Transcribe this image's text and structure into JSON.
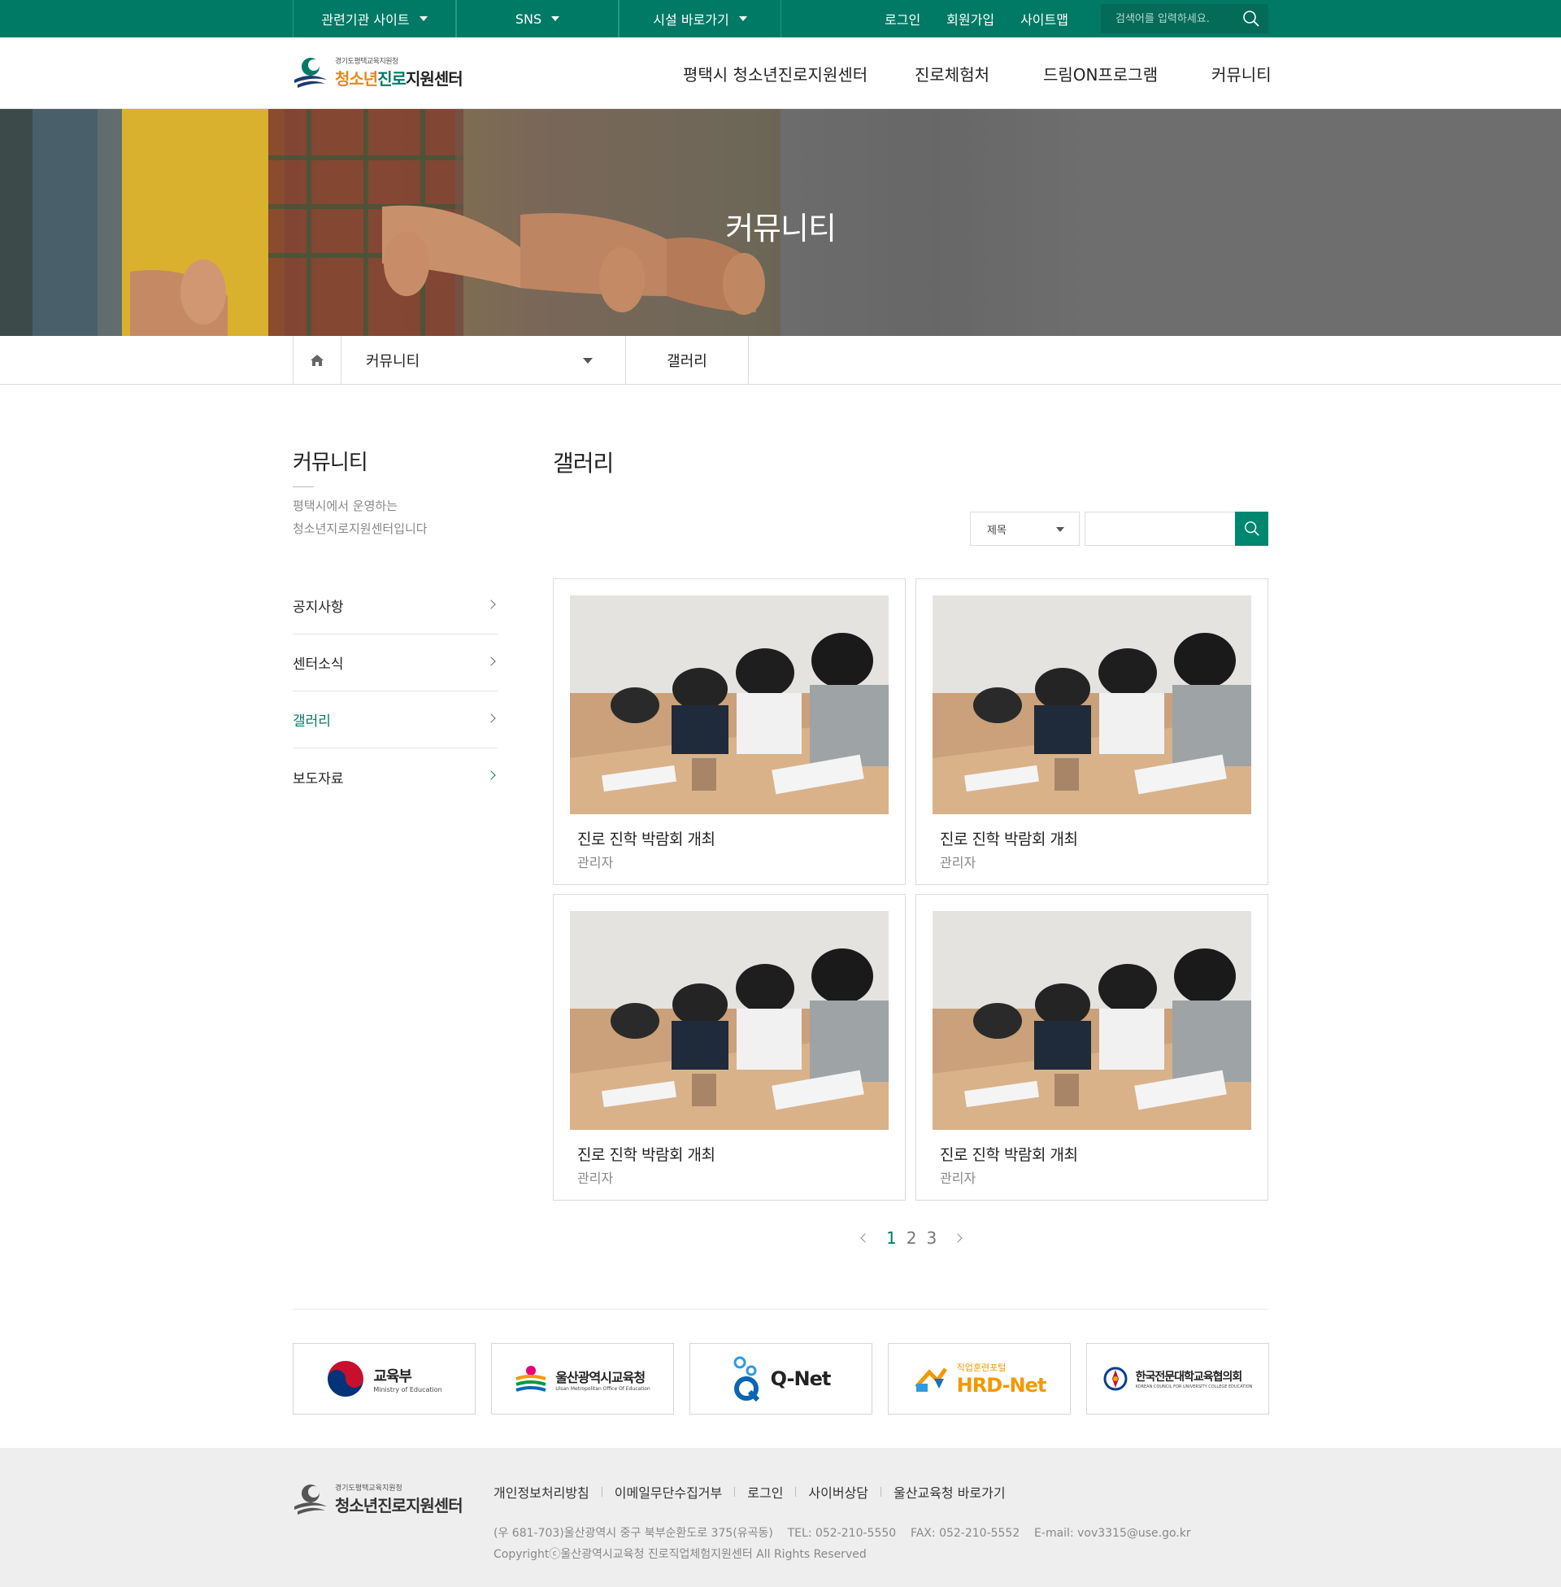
{
  "topbar": {
    "dropdowns": [
      "관련기관 사이트",
      "SNS",
      "시설 바로가기"
    ],
    "links": [
      "로그인",
      "회원가입",
      "사이트맵"
    ],
    "search_placeholder": "검색어를 입력하세요."
  },
  "header": {
    "logo_sub": "경기도평택교육지원청",
    "logo_part1": "청소년",
    "logo_part2": "진로",
    "logo_part3": "지원센터",
    "nav": [
      "평택시 청소년진로지원센터",
      "진로체험처",
      "드림ON프로그램",
      "커뮤니티"
    ]
  },
  "hero": {
    "title": "커뮤니티"
  },
  "breadcrumb": {
    "section": "커뮤니티",
    "current": "갤러리"
  },
  "sidebar": {
    "title": "커뮤니티",
    "desc_line1": "평택시에서 운영하는",
    "desc_line2": "청소년지로지원센터입니다",
    "items": [
      {
        "label": "공지사항",
        "active": false
      },
      {
        "label": "센터소식",
        "active": false
      },
      {
        "label": "갤러리",
        "active": true
      },
      {
        "label": "보도자료",
        "active": false
      }
    ]
  },
  "content": {
    "title": "갤러리",
    "filter_select": "제목",
    "search_value": ""
  },
  "gallery": [
    {
      "title": "진로 진학 박람회 개최",
      "author": "관리자"
    },
    {
      "title": "진로 진학 박람회 개최",
      "author": "관리자"
    },
    {
      "title": "진로 진학 박람회 개최",
      "author": "관리자"
    },
    {
      "title": "진로 진학 박람회 개최",
      "author": "관리자"
    }
  ],
  "pagination": {
    "pages": [
      "1",
      "2",
      "3"
    ],
    "current": "1"
  },
  "banners": [
    {
      "title": "교육부",
      "sub": "Ministry of Education"
    },
    {
      "title": "울산광역시교육청",
      "sub": "Ulsan Metropolitan Office Of Education"
    },
    {
      "title": "Q-Net",
      "sub": ""
    },
    {
      "title": "HRD-Net",
      "sub": "직업훈련포털"
    },
    {
      "title": "한국전문대학교육협의회",
      "sub": "KOREAN COUNCIL FOR UNIVERSITY COLLEGE EDUCATION"
    }
  ],
  "footer": {
    "logo_sub": "경기도평택교육지원청",
    "logo_main": "청소년진로지원센터",
    "links": [
      "개인정보처리방침",
      "이메일무단수집거부",
      "로그인",
      "사이버상담",
      "울산교육청 바로가기"
    ],
    "address": "(우 681-703)울산광역시 중구 북부순환도로 375(유곡동)    TEL: 052-210-5550    FAX: 052-210-5552    E-mail: vov3315@use.go.kr",
    "copyright": "Copyrightⓒ울산광역시교육청 진로직업체험지원센터 All Rights Reserved"
  },
  "colors": {
    "brand": "#007a65",
    "accent": "#e48a1c"
  }
}
